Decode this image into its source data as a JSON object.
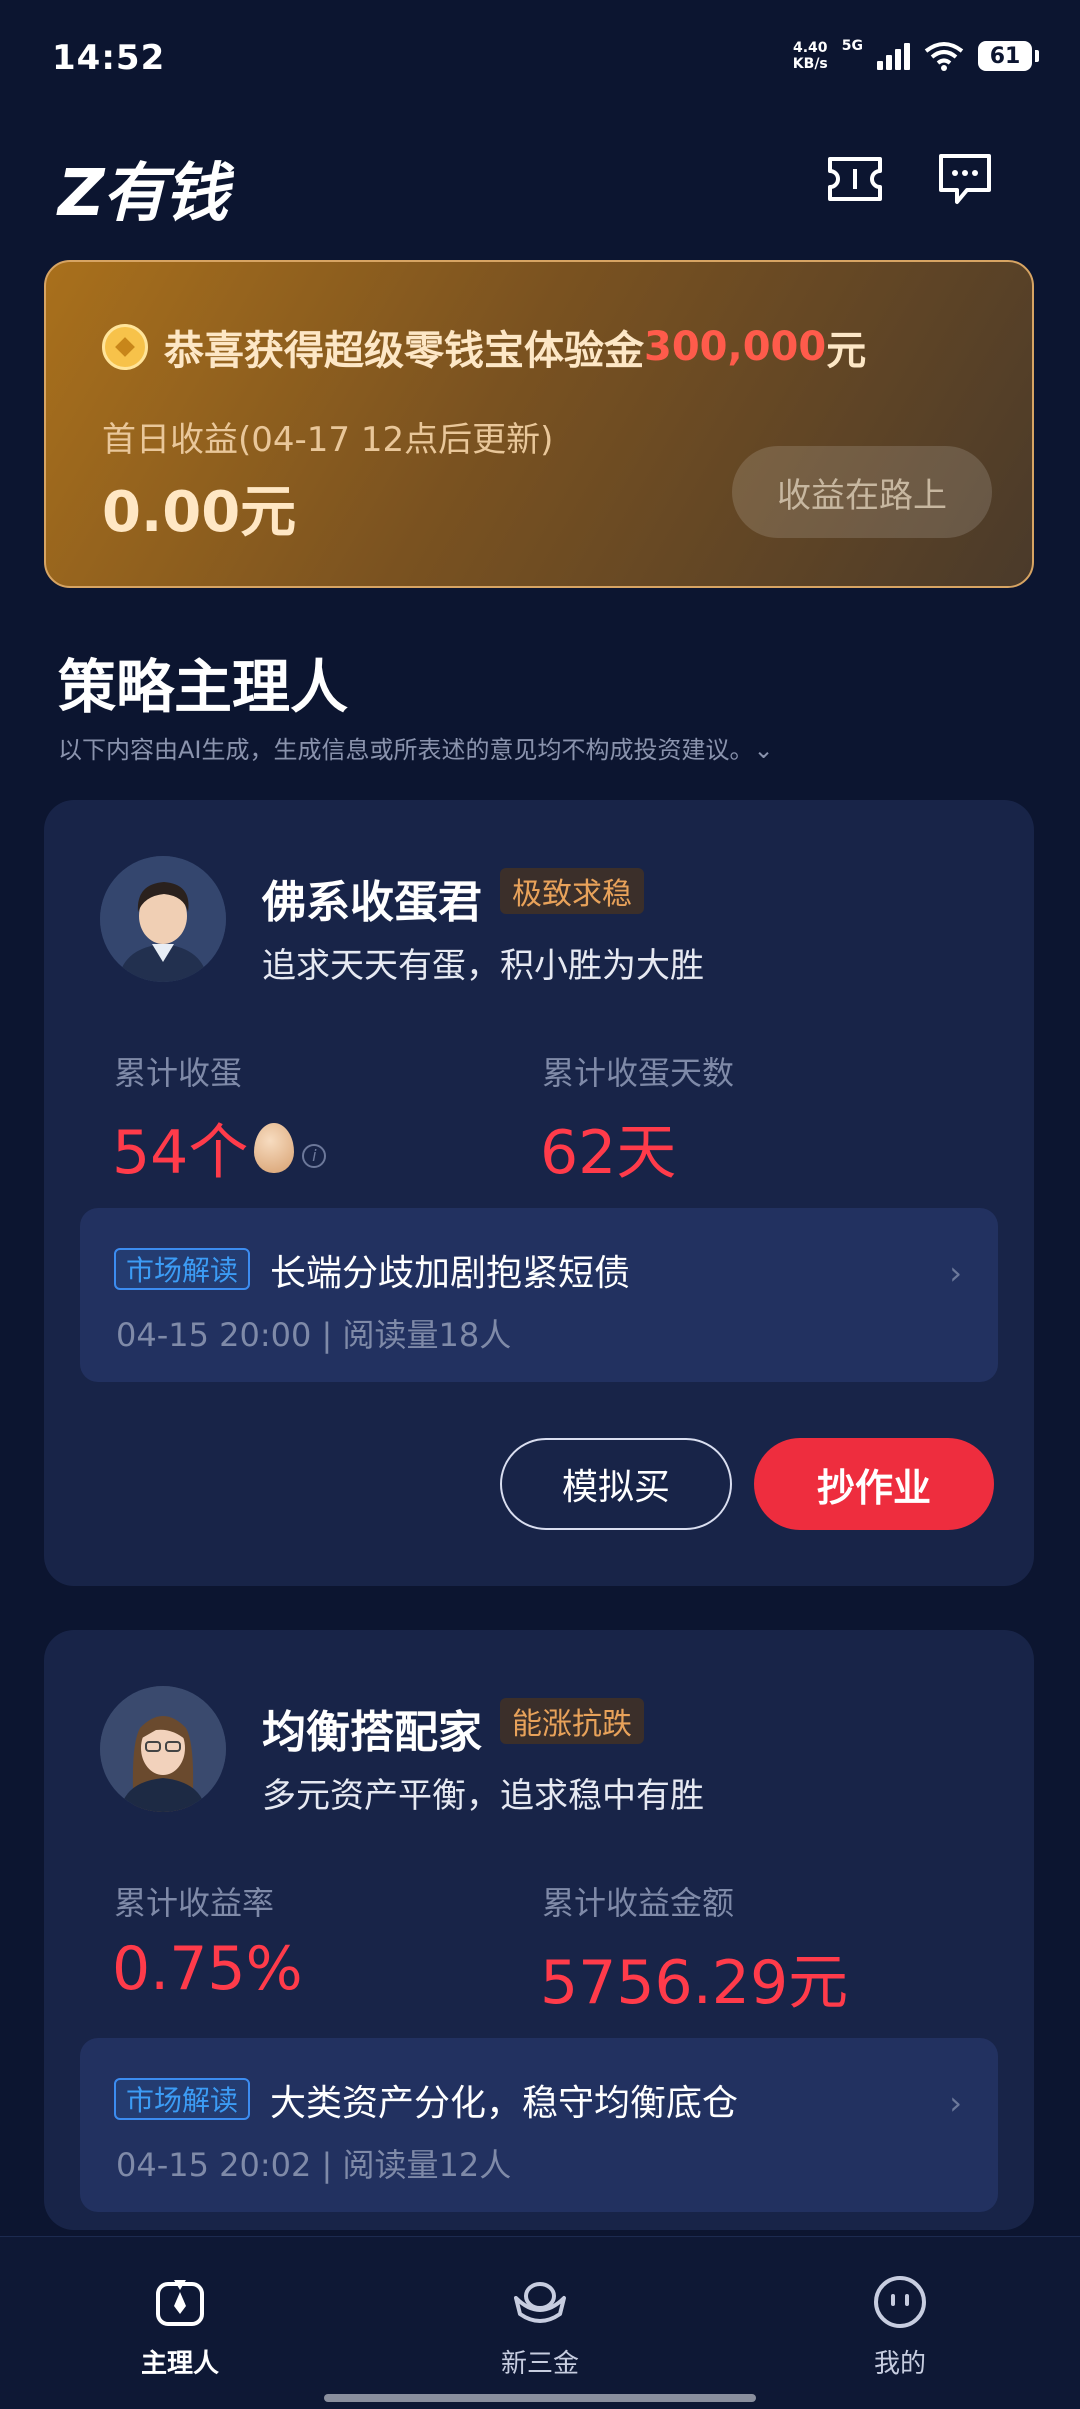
{
  "status": {
    "time": "14:52",
    "speed": "4.40",
    "speed_unit": "KB/s",
    "network": "5G",
    "battery": "61"
  },
  "header": {
    "logo": "Z有钱"
  },
  "bonus": {
    "title_prefix": "恭喜获得超级零钱宝体验金",
    "amount": "300,000",
    "unit": "元",
    "subtitle": "首日收益(04-17 12点后更新)",
    "value": "0.00元",
    "button": "收益在路上"
  },
  "section": {
    "title": "策略主理人",
    "note": "以下内容由AI生成，生成信息或所表述的意见均不构成投资建议。⌄"
  },
  "cards": [
    {
      "name": "佛系收蛋君",
      "tag": "极致求稳",
      "desc": "追求天天有蛋，积小胜为大胜",
      "stat1_label": "累计收蛋",
      "stat1_value": "54个",
      "stat2_label": "累计收蛋天数",
      "stat2_value": "62天",
      "news_tag": "市场解读",
      "news_title": "长端分歧加剧抱紧短债",
      "news_meta": "04-15 20:00 | 阅读量18人",
      "btn_simulate": "模拟买",
      "btn_copy": "抄作业"
    },
    {
      "name": "均衡搭配家",
      "tag": "能涨抗跌",
      "desc": "多元资产平衡，追求稳中有胜",
      "stat1_label": "累计收益率",
      "stat1_value": "0.75%",
      "stat2_label": "累计收益金额",
      "stat2_value": "5756.29元",
      "news_tag": "市场解读",
      "news_title": "大类资产分化，稳守均衡底仓",
      "news_meta": "04-15 20:02 | 阅读量12人"
    }
  ],
  "nav": [
    {
      "label": "主理人",
      "icon": "manager-icon",
      "active": true
    },
    {
      "label": "新三金",
      "icon": "ingot-icon",
      "active": false
    },
    {
      "label": "我的",
      "icon": "face-icon",
      "active": false
    }
  ]
}
